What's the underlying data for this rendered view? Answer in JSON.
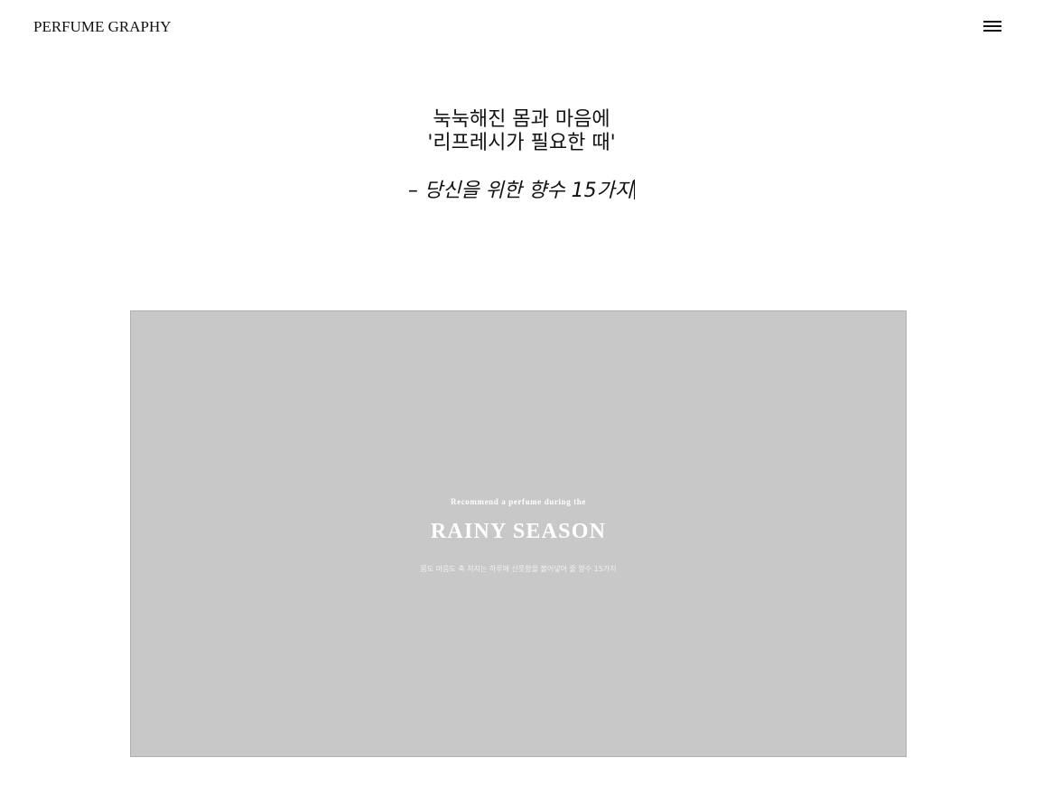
{
  "header": {
    "logo": "PERFUME GRAPHY",
    "menu_icon": "hamburger-menu-icon"
  },
  "intro": {
    "line1": "눅눅해진 몸과 마음에",
    "line2": "'리프레시가 필요한 때'",
    "subline": "– 당신을 위한 향수 15가지"
  },
  "hero": {
    "kicker": "Recommend a perfume during the",
    "title": "RAINY SEASON",
    "description": "몸도 마음도 축 처지는 하루에 산뜻함을 불어넣어 줄 향수 15가지"
  }
}
